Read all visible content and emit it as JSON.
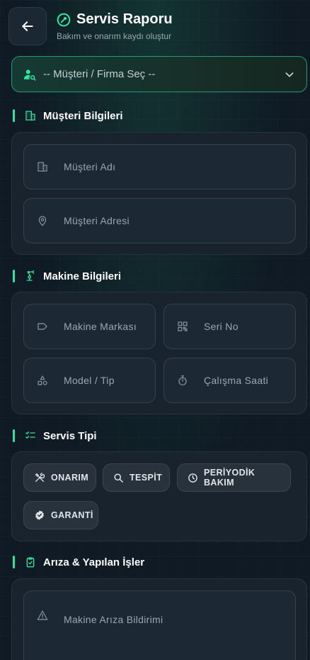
{
  "header": {
    "title": "Servis Raporu",
    "subtitle": "Bakım ve onarım kaydı oluştur"
  },
  "customer_select": {
    "placeholder": "-- Müşteri / Firma Seç --"
  },
  "sections": {
    "customer": {
      "title": "Müşteri Bilgileri",
      "fields": {
        "name": "Müşteri Adı",
        "address": "Müşteri Adresi"
      }
    },
    "machine": {
      "title": "Makine Bilgileri",
      "fields": {
        "brand": "Makine Markası",
        "serial": "Seri No",
        "model": "Model / Tip",
        "hours": "Çalışma Saati"
      }
    },
    "service_type": {
      "title": "Servis Tipi",
      "options": [
        "ONARIM",
        "TESPİT",
        "PERİYODİK BAKIM",
        "GARANTİ"
      ]
    },
    "fault": {
      "title": "Arıza & Yapılan İşler",
      "fields": {
        "report": "Makine Arıza Bildirimi"
      }
    }
  },
  "colors": {
    "accent": "#2ee59d",
    "background": "#0f1a24",
    "card": "#18232e"
  }
}
